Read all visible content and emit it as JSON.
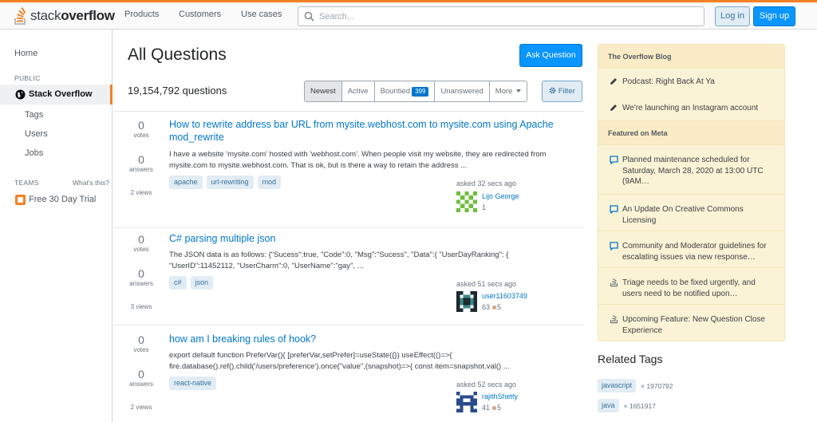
{
  "header": {
    "logo_prefix": "stack",
    "logo_suffix": "overflow",
    "nav": [
      "Products",
      "Customers",
      "Use cases"
    ],
    "search_placeholder": "Search...",
    "login_label": "Log in",
    "signup_label": "Sign up"
  },
  "sidebar": {
    "home": "Home",
    "public_label": "PUBLIC",
    "active_item": "Stack Overflow",
    "items": [
      "Tags",
      "Users",
      "Jobs"
    ],
    "teams_label": "TEAMS",
    "whats_this": "What's this?",
    "trial": "Free 30 Day Trial"
  },
  "main": {
    "title": "All Questions",
    "ask_button": "Ask Question",
    "question_count": "19,154,792 questions",
    "filters": [
      "Newest",
      "Active",
      "Bountied",
      "Unanswered",
      "More"
    ],
    "bounty_count": "399",
    "filter_button": "Filter",
    "questions": [
      {
        "votes": "0",
        "votes_label": "votes",
        "answers": "0",
        "answers_label": "answers",
        "views": "2 views",
        "title_line1": "How to rewrite address bar URL from mysite.webhost.com to mysite.com using Apache",
        "title_line2": "mod_rewrite",
        "excerpt_line1": "I have a website 'mysite.com' hosted with 'webhost.com'. When people visit my website, they are redirected from",
        "excerpt_line2": "mysite.com to mysite.webhost.com. That is ok, but is there a way to retain the address ...",
        "tags": [
          "apache",
          "url-rewriting",
          "mod"
        ],
        "asked": "asked 32 secs ago",
        "user": "Lijo George",
        "rep": "1",
        "bronze": ""
      },
      {
        "votes": "0",
        "votes_label": "votes",
        "answers": "0",
        "answers_label": "answers",
        "views": "3 views",
        "title_line1": "C# parsing multiple json",
        "excerpt_line1": "The JSON data is as follows:  {\"Sucess\":true, \"Code\":0, \"Msg\":\"Sucess\", \"Data\":{ \"UserDayRanking\": {",
        "excerpt_line2": "\"UserID\":11452112, \"UserCharm\":0, \"UserName\":\"gay\", ...",
        "tags": [
          "c#",
          "json"
        ],
        "asked": "asked 51 secs ago",
        "user": "user11603749",
        "rep": "63",
        "bronze": "5"
      },
      {
        "votes": "0",
        "votes_label": "votes",
        "answers": "0",
        "answers_label": "answers",
        "views": "2 views",
        "title_line1": "how am I breaking rules of hook?",
        "excerpt_line1": "export default function PreferVar(){ [preferVar,setPrefer]=useState({}) useEffect(()=>{",
        "excerpt_line2": "fire.database().ref().child('/users/preference').once(\"value\",(snapshot)=>{ const item=snapshot.val() ...",
        "tags": [
          "react-native"
        ],
        "asked": "asked 52 secs ago",
        "user": "rajithShetty",
        "rep": "41",
        "bronze": "5"
      }
    ]
  },
  "right": {
    "blog_title": "The Overflow Blog",
    "blog_items": [
      "Podcast: Right Back At Ya",
      "We're launching an Instagram account"
    ],
    "meta_title": "Featured on Meta",
    "meta_items": [
      {
        "line1": "Planned maintenance scheduled for",
        "line2": "Saturday, March 28, 2020 at 13:00 UTC",
        "line3": "(9AM…"
      },
      {
        "line1": "An Update On Creative Commons",
        "line2": "Licensing"
      },
      {
        "line1": "Community and Moderator guidelines for",
        "line2": "escalating issues via new response…"
      },
      {
        "line1": "Triage needs to be fixed urgently, and",
        "line2": "users need to be notified upon…"
      },
      {
        "line1": "Upcoming Feature: New Question Close",
        "line2": "Experience"
      }
    ],
    "related_title": "Related Tags",
    "related_tags": [
      {
        "name": "javascript",
        "count": "× 1970792"
      },
      {
        "name": "java",
        "count": "× 1651917"
      }
    ]
  },
  "colors": {
    "accent": "#f48024",
    "link": "#0077cc",
    "primary_button": "#0a95ff",
    "blog_bg": "#fbf3d5"
  }
}
